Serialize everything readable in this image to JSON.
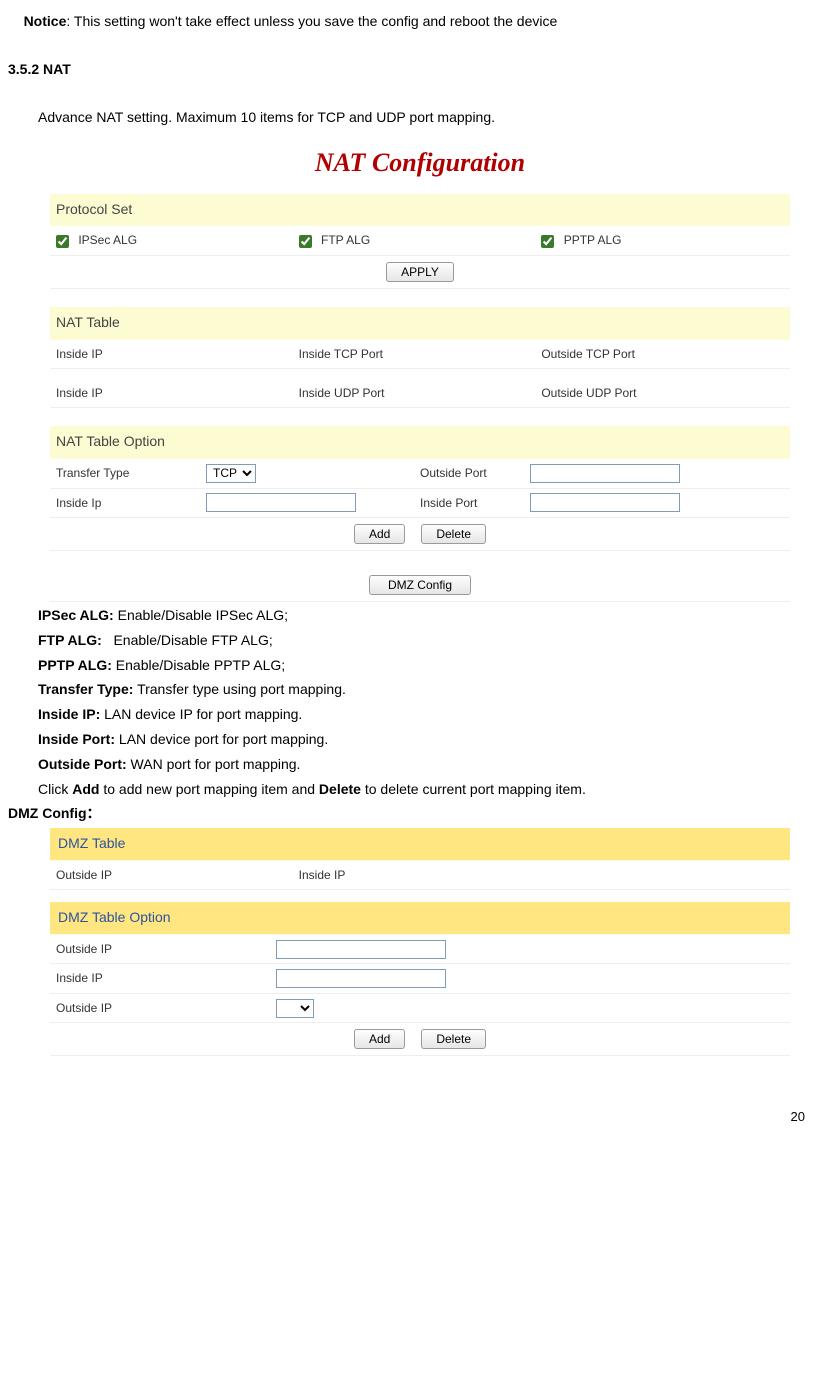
{
  "notice": {
    "label": "Notice",
    "text": ": This setting won't take effect unless you save the config and reboot the device"
  },
  "section_heading": "3.5.2 NAT",
  "intro": "Advance NAT setting. Maximum 10 items for TCP and UDP port mapping.",
  "nat_panel": {
    "title": "NAT Configuration",
    "protocol_set": {
      "heading": "Protocol Set",
      "ipsec": "IPSec ALG",
      "ftp": "FTP ALG",
      "pptp": "PPTP ALG",
      "apply": "APPLY"
    },
    "nat_table": {
      "heading": "NAT Table",
      "row1": {
        "c1": "Inside IP",
        "c2": "Inside TCP Port",
        "c3": "Outside TCP Port"
      },
      "row2": {
        "c1": "Inside IP",
        "c2": "Inside UDP Port",
        "c3": "Outside UDP Port"
      }
    },
    "nat_option": {
      "heading": "NAT Table Option",
      "transfer_type": "Transfer Type",
      "transfer_value": "TCP",
      "outside_port": "Outside Port",
      "inside_ip": "Inside Ip",
      "inside_port": "Inside Port",
      "add": "Add",
      "delete": "Delete",
      "dmz": "DMZ Config"
    }
  },
  "defs": {
    "ipsec_k": "IPSec ALG:",
    "ipsec_v": " Enable/Disable IPSec ALG;",
    "ftp_k": "FTP ALG:",
    "ftp_v": "   Enable/Disable FTP ALG;",
    "pptp_k": "PPTP ALG:",
    "pptp_v": " Enable/Disable PPTP ALG;",
    "tt_k": "Transfer Type:",
    "tt_v": " Transfer type using port mapping.",
    "iip_k": "Inside IP:",
    "iip_v": " LAN device IP for port mapping.",
    "ipt_k": "Inside Port:",
    "ipt_v": " LAN device port for port mapping.",
    "opt_k": "Outside Port:",
    "opt_v": " WAN port for port mapping."
  },
  "click_line": {
    "pre": "Click ",
    "add": "Add",
    "mid": " to add new port mapping item and ",
    "del": "Delete",
    "post": " to delete current port mapping item."
  },
  "dmz_heading": "DMZ Config：",
  "dmz_panel": {
    "table_heading": "DMZ Table",
    "outside_ip": "Outside IP",
    "inside_ip": "Inside IP",
    "option_heading": "DMZ Table Option",
    "opt_outside": "Outside IP",
    "opt_inside": "Inside IP",
    "opt_outside2": "Outside IP",
    "add": "Add",
    "delete": "Delete"
  },
  "page_number": "20"
}
